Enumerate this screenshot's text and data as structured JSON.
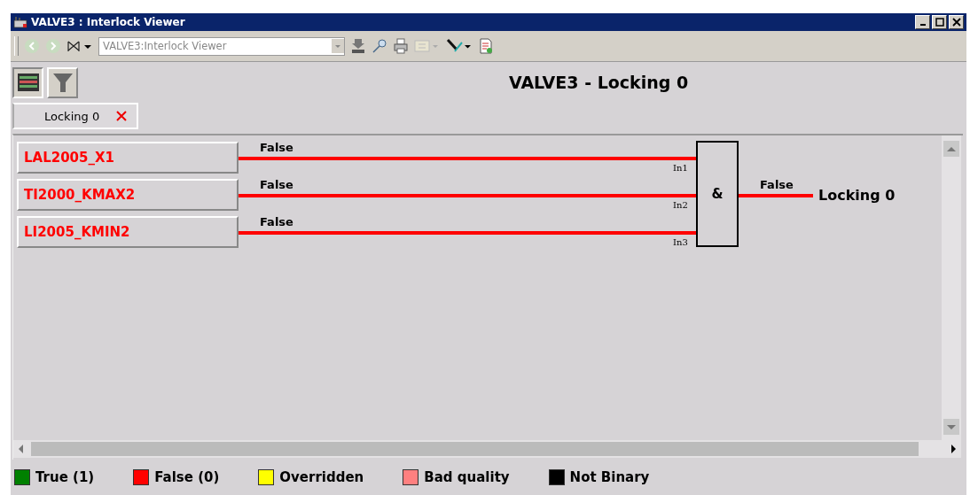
{
  "window": {
    "title": "VALVE3 : Interlock Viewer"
  },
  "toolbar": {
    "address": "VALVE3:Interlock Viewer"
  },
  "heading": "VALVE3 - Locking 0",
  "tabs": [
    {
      "label": "Locking 0",
      "selected": true
    }
  ],
  "diagram": {
    "inputs": [
      {
        "name": "LAL2005_X1",
        "value": "False",
        "pin": "In1",
        "active": false
      },
      {
        "name": "TI2000_KMAX2",
        "value": "False",
        "pin": "In2",
        "active": false
      },
      {
        "name": "LI2005_KMIN2",
        "value": "False",
        "pin": "In3",
        "active": false
      }
    ],
    "gate": {
      "symbol": "&"
    },
    "output": {
      "value": "False",
      "label": "Locking 0",
      "active": false
    }
  },
  "legend": [
    {
      "label": "True (1)",
      "color": "#008000"
    },
    {
      "label": "False (0)",
      "color": "#ff0000"
    },
    {
      "label": "Overridden",
      "color": "#ffff00"
    },
    {
      "label": "Bad quality",
      "color": "#ff8080"
    },
    {
      "label": "Not Binary",
      "color": "#000000"
    }
  ]
}
